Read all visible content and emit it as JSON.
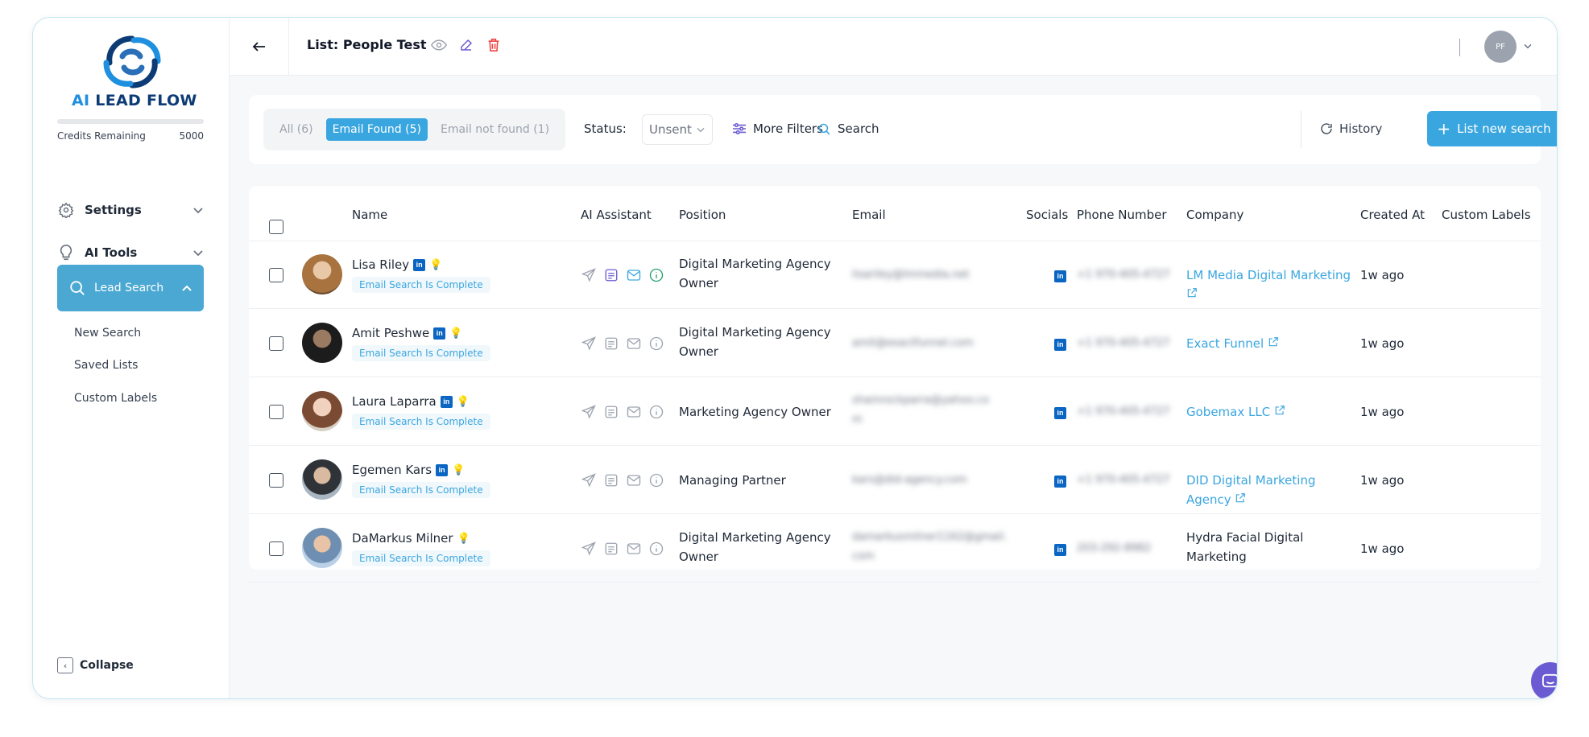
{
  "sidebar": {
    "logo_prefix": "AI",
    "logo_text": "LEAD FLOW",
    "credits_label": "Credits Remaining",
    "credits_value": "5000",
    "settings": "Settings",
    "ai_tools": "AI Tools",
    "lead_search": "Lead Search",
    "sub_items": [
      "New Search",
      "Saved Lists",
      "Custom Labels"
    ],
    "collapse": "Collapse"
  },
  "topbar": {
    "title": "List: People Test",
    "avatar_initials": "PF"
  },
  "filters": {
    "tabs": [
      "All (6)",
      "Email Found (5)",
      "Email not found (1)"
    ],
    "active_tab": 1,
    "status_label": "Status:",
    "status_value": "Unsent",
    "more_filters": "More Filters",
    "search": "Search",
    "history": "History",
    "new_search": "List new search"
  },
  "table": {
    "headers": [
      "Name",
      "AI Assistant",
      "Position",
      "Email",
      "Socials",
      "Phone Number",
      "Company",
      "Created At",
      "Custom Labels"
    ],
    "rows": [
      {
        "name": "Lisa Riley",
        "linkedin": true,
        "status": "Email Search Is Complete",
        "position_1": "Digital Marketing Agency",
        "position_2": "Owner",
        "email_1": "lisariley@lmmedia.net",
        "email_2": "",
        "phone": "+1 970-405-4727",
        "company_1": "LM Media Digital Marketing",
        "company_2": "",
        "company_link": true,
        "created": "1w ago",
        "ai_active": true
      },
      {
        "name": "Amit Peshwe",
        "linkedin": true,
        "status": "Email Search Is Complete",
        "position_1": "Digital Marketing Agency",
        "position_2": "Owner",
        "email_1": "amit@exactfunnel.com",
        "email_2": "",
        "phone": "+1 970-405-4727",
        "company_1": "Exact Funnel",
        "company_2": "",
        "company_link": true,
        "created": "1w ago",
        "ai_active": false
      },
      {
        "name": "Laura Laparra",
        "linkedin": true,
        "status": "Email Search Is Complete",
        "position_1": "Marketing Agency Owner",
        "position_2": "",
        "email_1": "shamrockparra@yahoo.co",
        "email_2": "m",
        "phone": "+1 970-405-4727",
        "company_1": "Gobemax LLC",
        "company_2": "",
        "company_link": true,
        "created": "1w ago",
        "ai_active": false
      },
      {
        "name": "Egemen Kars",
        "linkedin": true,
        "status": "Email Search Is Complete",
        "position_1": "Managing Partner",
        "position_2": "",
        "email_1": "kars@did-agency.com",
        "email_2": "",
        "phone": "+1 970-405-4727",
        "company_1": "DID Digital Marketing Agency",
        "company_2": "",
        "company_link": true,
        "created": "1w ago",
        "ai_active": false
      },
      {
        "name": "DaMarkus Milner",
        "linkedin": false,
        "status": "Email Search Is Complete",
        "position_1": "Digital Marketing Agency",
        "position_2": "Owner",
        "email_1": "damarkusmilner1162@gmail.",
        "email_2": "com",
        "phone": "203-292-8982",
        "company_1": "Hydra Facial Digital",
        "company_2": "Marketing",
        "company_link": false,
        "created": "1w ago",
        "ai_active": false
      }
    ]
  },
  "colors": {
    "accent": "#3aa6e0",
    "brand_dark": "#0d3b75",
    "sidebar_active": "#4aa8d3",
    "linkedin": "#0a66c2",
    "chat": "#6b5bd3"
  }
}
